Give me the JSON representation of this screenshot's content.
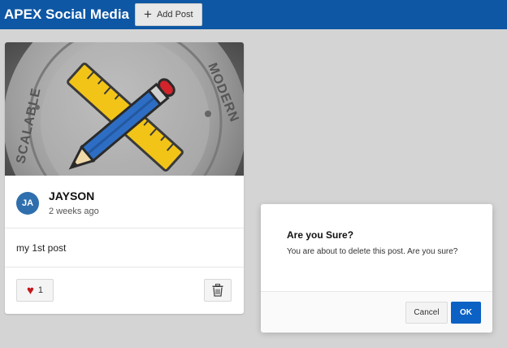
{
  "header": {
    "app_title": "APEX Social Media",
    "add_post_icon": "plus-icon",
    "add_post_label": "Add Post",
    "color": "#0e57a4"
  },
  "post": {
    "image_text": {
      "left": "SCALABLE",
      "right": "MODERN"
    },
    "avatar_initials": "JA",
    "author": "JAYSON",
    "time": "2 weeks ago",
    "text": "my 1st post",
    "like_icon": "heart-icon",
    "like_count": "1",
    "delete_icon": "trash-icon"
  },
  "dialog": {
    "title": "Are you Sure?",
    "message": "You are about to delete this post. Are you sure?",
    "cancel_label": "Cancel",
    "ok_label": "OK",
    "ok_color": "#0b61c4"
  }
}
